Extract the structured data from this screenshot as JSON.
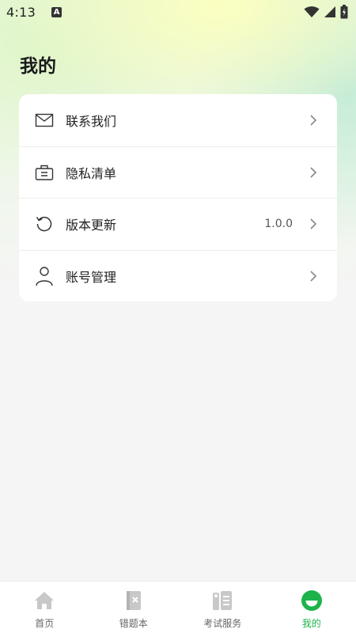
{
  "status_bar": {
    "time": "4:13",
    "notification_letter": "A"
  },
  "page": {
    "title": "我的"
  },
  "menu": {
    "items": [
      {
        "label": "联系我们",
        "icon": "mail-icon",
        "value": ""
      },
      {
        "label": "隐私清单",
        "icon": "briefcase-icon",
        "value": ""
      },
      {
        "label": "版本更新",
        "icon": "refresh-icon",
        "value": "1.0.0"
      },
      {
        "label": "账号管理",
        "icon": "user-icon",
        "value": ""
      }
    ]
  },
  "tabs": {
    "items": [
      {
        "label": "首页",
        "icon": "home-icon",
        "active": false
      },
      {
        "label": "错题本",
        "icon": "wrong-notebook-icon",
        "active": false
      },
      {
        "label": "考试服务",
        "icon": "exam-service-icon",
        "active": false
      },
      {
        "label": "我的",
        "icon": "profile-face-icon",
        "active": true
      }
    ]
  },
  "colors": {
    "accent": "#1db34a",
    "inactive_icon": "#c8c8c8",
    "text_primary": "#222222"
  }
}
